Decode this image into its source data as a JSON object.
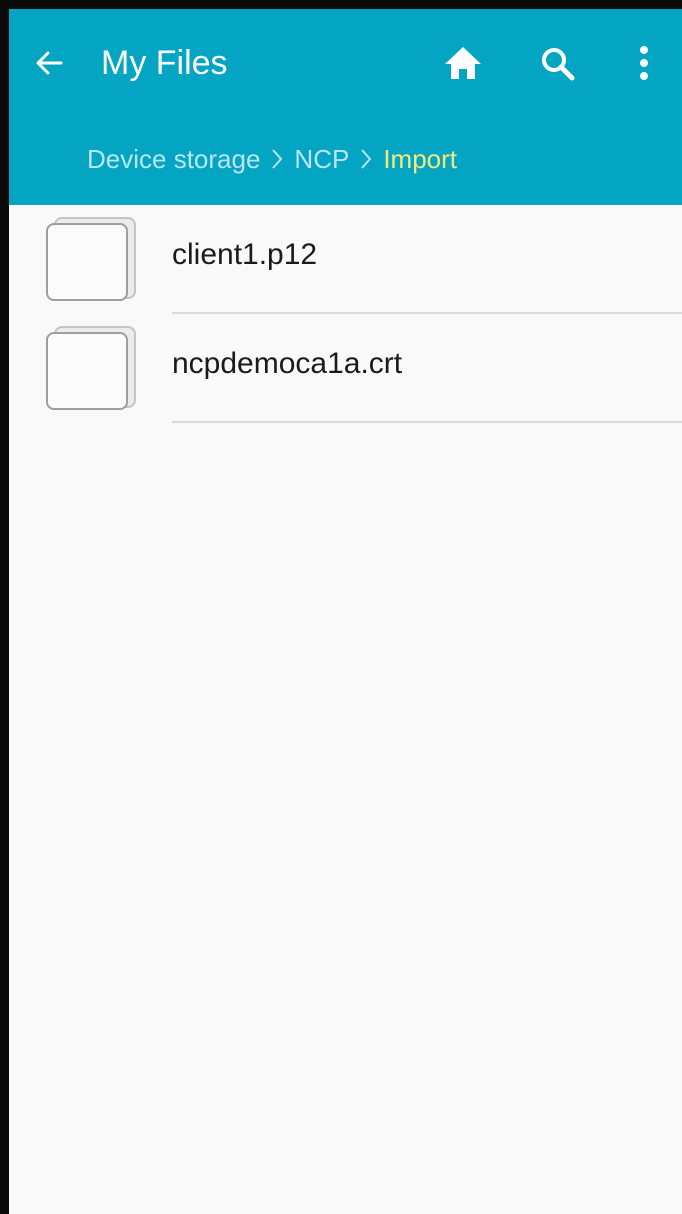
{
  "appbar": {
    "title": "My Files",
    "back_icon": "arrow-left-icon",
    "home_icon": "home-icon",
    "search_icon": "search-icon",
    "more_icon": "more-vertical-icon",
    "background_color": "#04a5c3"
  },
  "breadcrumb": {
    "items": [
      {
        "label": "Device storage",
        "current": false
      },
      {
        "label": "NCP",
        "current": false
      },
      {
        "label": "Import",
        "current": true
      }
    ],
    "separator_icon": "chevron-right-icon",
    "color": "#b8e6f0",
    "current_color": "#f3ea7e"
  },
  "files": [
    {
      "name": "client1.p12",
      "icon": "file-icon"
    },
    {
      "name": "ncpdemoca1a.crt",
      "icon": "file-icon"
    }
  ]
}
